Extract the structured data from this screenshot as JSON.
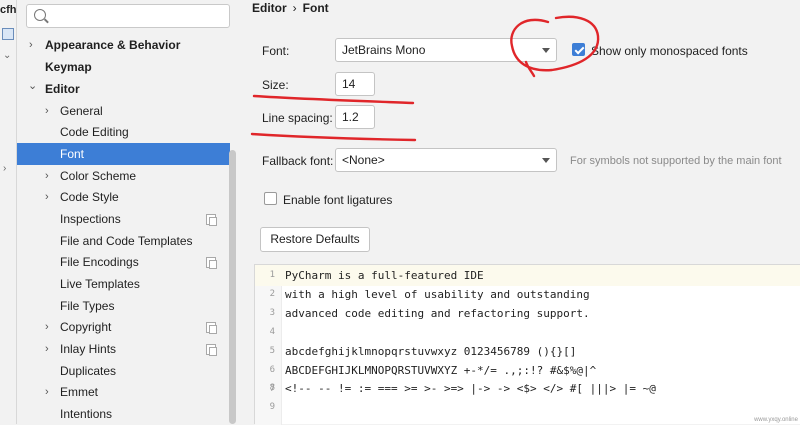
{
  "left_strip": {
    "fragment": "cfh"
  },
  "sidebar": {
    "search_placeholder": "",
    "items": [
      {
        "label": "Appearance & Behavior",
        "chevron": "›"
      },
      {
        "label": "Keymap"
      },
      {
        "label": "Editor",
        "chevron": "⌄"
      },
      {
        "label": "General",
        "chevron": "›"
      },
      {
        "label": "Code Editing"
      },
      {
        "label": "Font"
      },
      {
        "label": "Color Scheme",
        "chevron": "›"
      },
      {
        "label": "Code Style",
        "chevron": "›"
      },
      {
        "label": "Inspections"
      },
      {
        "label": "File and Code Templates"
      },
      {
        "label": "File Encodings"
      },
      {
        "label": "Live Templates"
      },
      {
        "label": "File Types"
      },
      {
        "label": "Copyright",
        "chevron": "›"
      },
      {
        "label": "Inlay Hints",
        "chevron": "›"
      },
      {
        "label": "Duplicates"
      },
      {
        "label": "Emmet",
        "chevron": "›"
      },
      {
        "label": "Intentions"
      }
    ]
  },
  "breadcrumb": {
    "parent": "Editor",
    "separator": "›",
    "current": "Font"
  },
  "font_settings": {
    "font_label": "Font:",
    "font_value": "JetBrains Mono",
    "monospaced_label": "Show only monospaced fonts",
    "monospaced_checked": true,
    "size_label": "Size:",
    "size_value": "14",
    "line_spacing_label": "Line spacing:",
    "line_spacing_value": "1.2",
    "fallback_label": "Fallback font:",
    "fallback_value": "<None>",
    "fallback_hint": "For symbols not supported by the main font",
    "ligatures_label": "Enable font ligatures",
    "ligatures_checked": false,
    "restore_button": "Restore Defaults"
  },
  "preview": {
    "lines": [
      {
        "num": "1",
        "text": "PyCharm is a full-featured IDE"
      },
      {
        "num": "2",
        "text": "with a high level of usability and outstanding"
      },
      {
        "num": "3",
        "text": "advanced code editing and refactoring support."
      },
      {
        "num": "4",
        "text": ""
      },
      {
        "num": "5",
        "text": "abcdefghijklmnopqrstuvwxyz 0123456789 (){}[]"
      },
      {
        "num": "6",
        "text": "ABCDEFGHIJKLMNOPQRSTUVWXYZ +-*/= .,;:!? #&$%@|^"
      },
      {
        "num": "7",
        "text": ""
      },
      {
        "num": "8",
        "text": "<!-- -- != := === >= >- >=> |-> -> <$> </> #[ |||> |= ~@"
      },
      {
        "num": "9",
        "text": ""
      }
    ]
  },
  "annotations": {
    "color": "#e0262a"
  },
  "watermark": "www.yxqy.online"
}
